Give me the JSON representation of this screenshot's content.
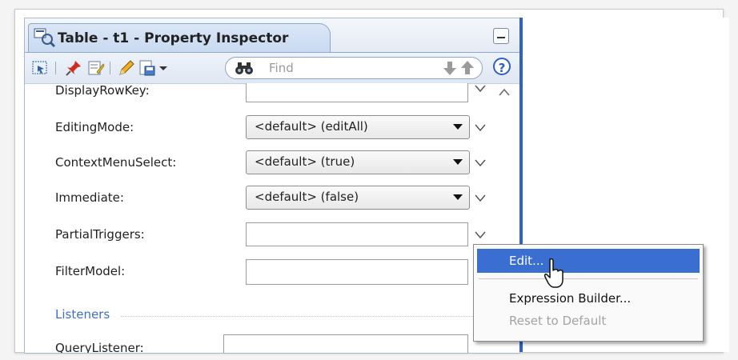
{
  "window": {
    "title": "Table - t1 - Property Inspector"
  },
  "toolbar": {
    "find_placeholder": "Find",
    "help_label": "?"
  },
  "properties": [
    {
      "label": "DisplayRowKey:",
      "type": "text",
      "value": ""
    },
    {
      "label": "EditingMode:",
      "type": "select",
      "value": "<default> (editAll)"
    },
    {
      "label": "ContextMenuSelect:",
      "type": "select",
      "value": "<default> (true)"
    },
    {
      "label": "Immediate:",
      "type": "select",
      "value": "<default> (false)"
    },
    {
      "label": "PartialTriggers:",
      "type": "text",
      "value": ""
    },
    {
      "label": "FilterModel:",
      "type": "text",
      "value": ""
    }
  ],
  "sections": {
    "listeners": "Listeners"
  },
  "listeners": [
    {
      "label": "QueryListener:",
      "value": ""
    }
  ],
  "context_menu": {
    "items": [
      {
        "label": "Edit...",
        "state": "selected"
      },
      {
        "label": "Expression Builder...",
        "state": "enabled"
      },
      {
        "label": "Reset to Default",
        "state": "disabled"
      }
    ]
  },
  "colors": {
    "accent": "#3a6fd1",
    "section_label": "#3d6fc9",
    "divider": "#2f61c9"
  }
}
